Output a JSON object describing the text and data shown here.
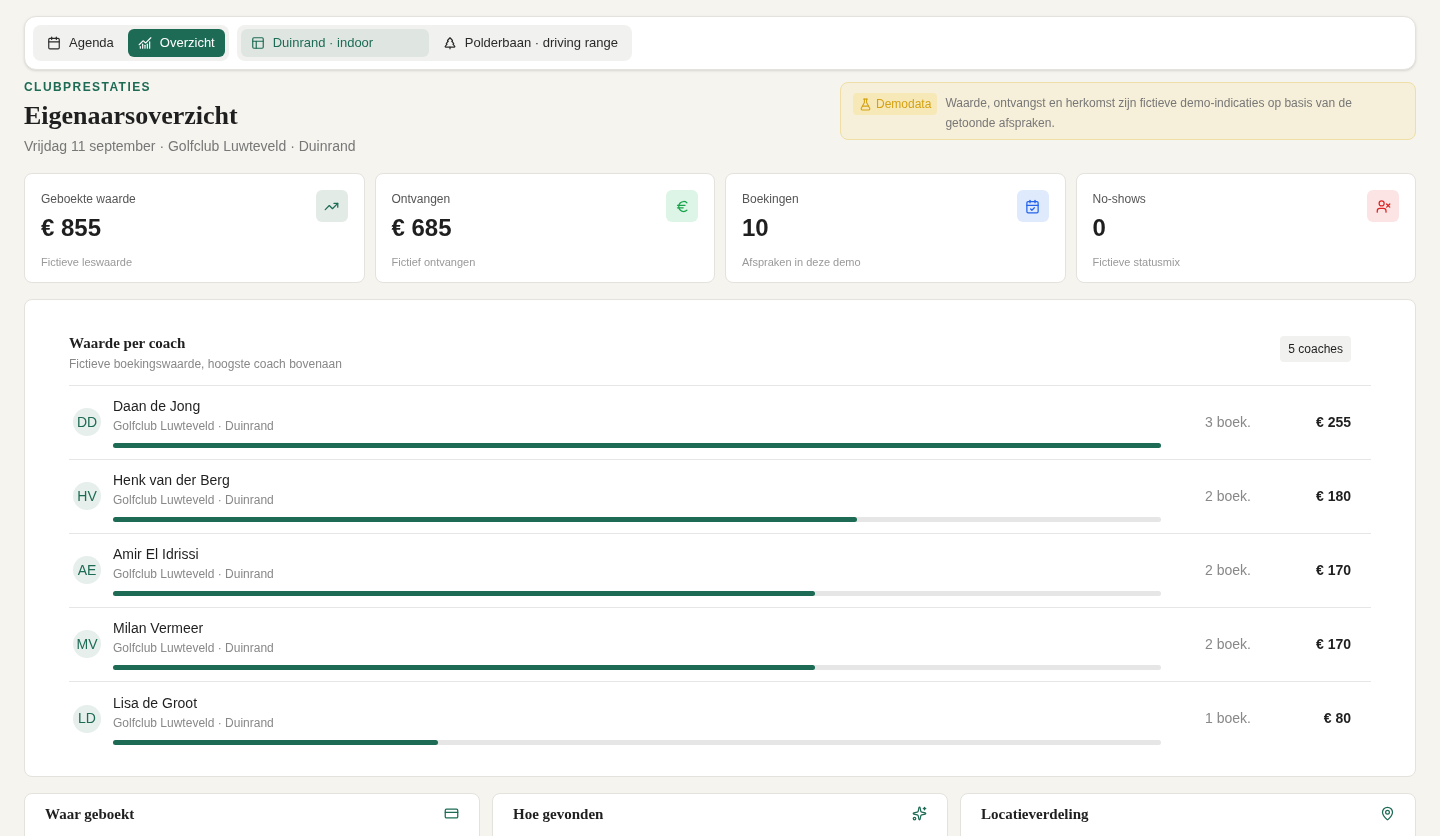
{
  "nav": {
    "views": [
      {
        "label": "Agenda",
        "selected": false
      },
      {
        "label": "Overzicht",
        "selected": true
      }
    ],
    "locations": [
      {
        "label": "Duinrand · indoor",
        "selected": true
      },
      {
        "label": "Polderbaan · driving range",
        "selected": false
      }
    ]
  },
  "header": {
    "eyebrow": "CLUBPRESTATIES",
    "title": "Eigenaarsoverzicht",
    "subtitle": "Vrijdag 11 september · Golfclub Luwteveld · Duinrand"
  },
  "notice": {
    "badge": "Demodata",
    "text": "Waarde, ontvangst en herkomst zijn fictieve demo-indicaties op basis van de getoonde afspraken."
  },
  "stats": [
    {
      "label": "Geboekte waarde",
      "value": "€ 855",
      "note": "Fictieve leswaarde"
    },
    {
      "label": "Ontvangen",
      "value": "€ 685",
      "note": "Fictief ontvangen"
    },
    {
      "label": "Boekingen",
      "value": "10",
      "note": "Afspraken in deze demo"
    },
    {
      "label": "No-shows",
      "value": "0",
      "note": "Fictieve statusmix"
    }
  ],
  "coaches": {
    "title": "Waarde per coach",
    "subtitle": "Fictieve boekingswaarde, hoogste coach bovenaan",
    "count": "5 coaches",
    "rows": [
      {
        "initials": "DD",
        "name": "Daan de Jong",
        "club": "Golfclub Luwteveld · Duinrand",
        "bookings": "3 boek.",
        "value": "€ 255",
        "level": 1
      },
      {
        "initials": "HV",
        "name": "Henk van der Berg",
        "club": "Golfclub Luwteveld · Duinrand",
        "bookings": "2 boek.",
        "value": "€ 180",
        "level": 0.71
      },
      {
        "initials": "AE",
        "name": "Amir El Idrissi",
        "club": "Golfclub Luwteveld · Duinrand",
        "bookings": "2 boek.",
        "value": "€ 170",
        "level": 0.67
      },
      {
        "initials": "MV",
        "name": "Milan Vermeer",
        "club": "Golfclub Luwteveld · Duinrand",
        "bookings": "2 boek.",
        "value": "€ 170",
        "level": 0.67
      },
      {
        "initials": "LD",
        "name": "Lisa de Groot",
        "club": "Golfclub Luwteveld · Duinrand",
        "bookings": "1 boek.",
        "value": "€ 80",
        "level": 0.31
      }
    ]
  },
  "bottom_cards": [
    {
      "title": "Waar geboekt"
    },
    {
      "title": "Hoe gevonden"
    },
    {
      "title": "Locatieverdeling"
    }
  ]
}
